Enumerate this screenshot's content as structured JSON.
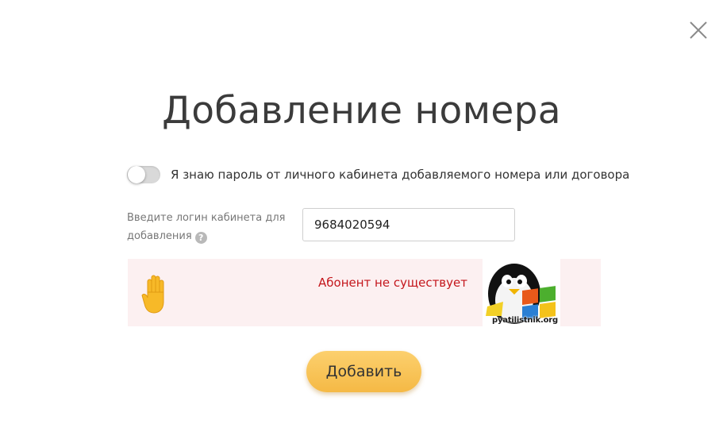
{
  "dialog": {
    "title": "Добавление номера",
    "close_icon": "close-icon"
  },
  "toggle": {
    "state": "off",
    "label": "Я знаю пароль от личного кабинета добавляемого номера или договора"
  },
  "login": {
    "label": "Введите логин кабинета для добавления",
    "help_icon": "question-icon",
    "help_glyph": "?",
    "value": "9684020594"
  },
  "error": {
    "icon": "raised-hand-icon",
    "message": "Абонент не существует"
  },
  "watermark": {
    "text": "pyatilistnik.org"
  },
  "actions": {
    "add_label": "Добавить"
  },
  "colors": {
    "accent": "#f5b945",
    "error_text": "#c4161c",
    "error_bg": "#fcf0f1"
  }
}
